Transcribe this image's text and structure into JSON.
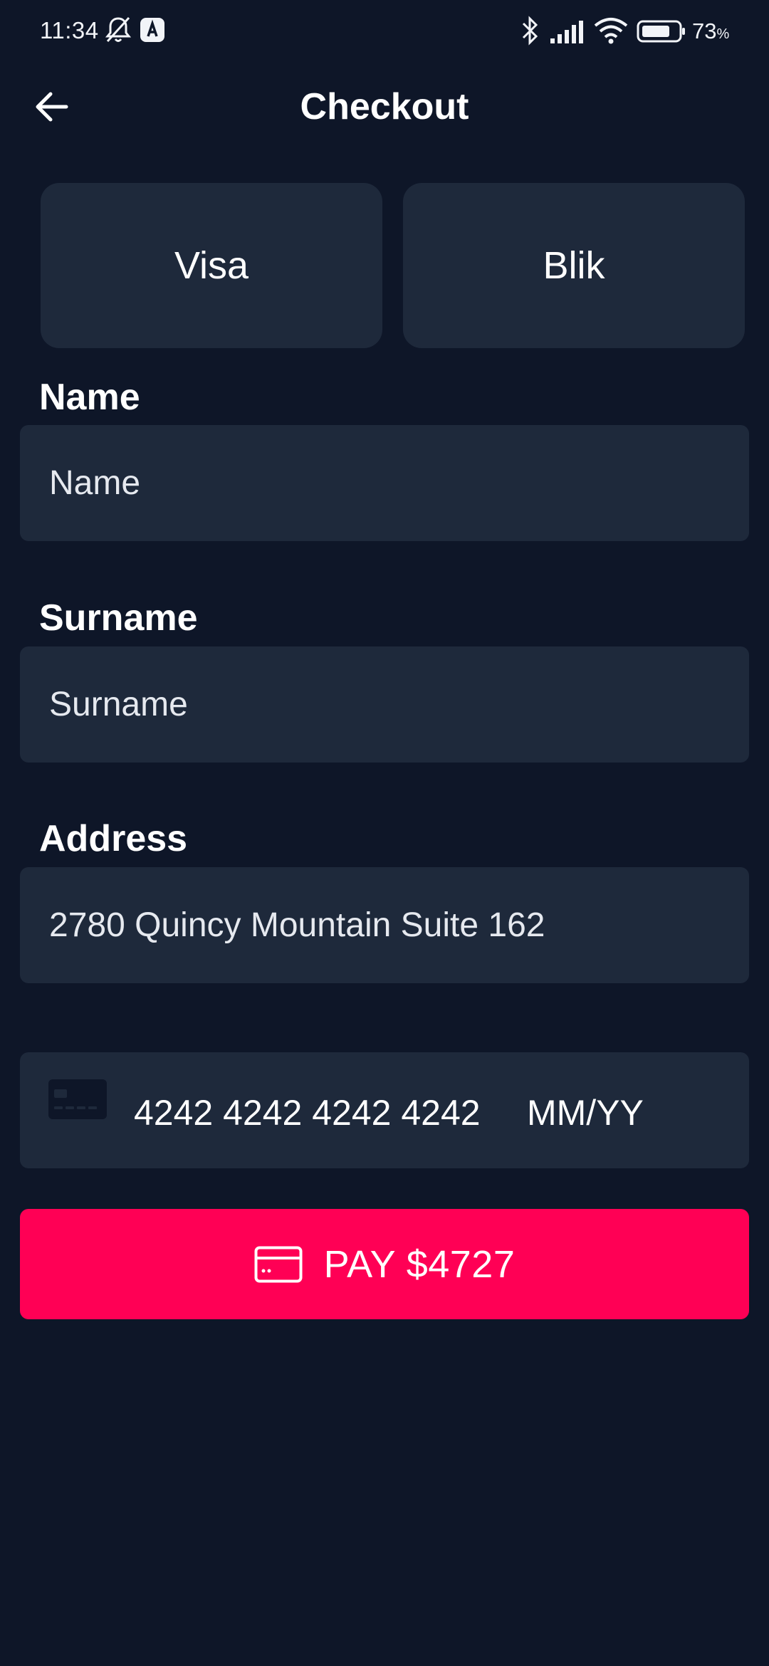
{
  "status_bar": {
    "time": "11:34",
    "battery_percent": "73",
    "battery_suffix": "%",
    "icons": [
      "bell-off-icon",
      "app-notification-icon",
      "bluetooth-icon",
      "signal-icon",
      "wifi-icon",
      "battery-icon"
    ]
  },
  "header": {
    "title": "Checkout",
    "back_icon": "arrow-left-icon"
  },
  "payment_methods": [
    {
      "label": "Visa"
    },
    {
      "label": "Blik"
    }
  ],
  "form": {
    "name": {
      "label": "Name",
      "placeholder": "Name",
      "value": ""
    },
    "surname": {
      "label": "Surname",
      "placeholder": "Surname",
      "value": ""
    },
    "address": {
      "label": "Address",
      "placeholder": "",
      "value": "2780 Quincy Mountain Suite 162"
    }
  },
  "card": {
    "icon": "credit-card-icon",
    "number": "4242 4242 4242 4242",
    "expiry_placeholder": "MM/YY"
  },
  "pay_button": {
    "icon": "card-icon",
    "label": "PAY $4727"
  },
  "colors": {
    "background": "#0e1628",
    "surface": "#1e293b",
    "accent": "#ff0055",
    "text": "#ffffff"
  }
}
